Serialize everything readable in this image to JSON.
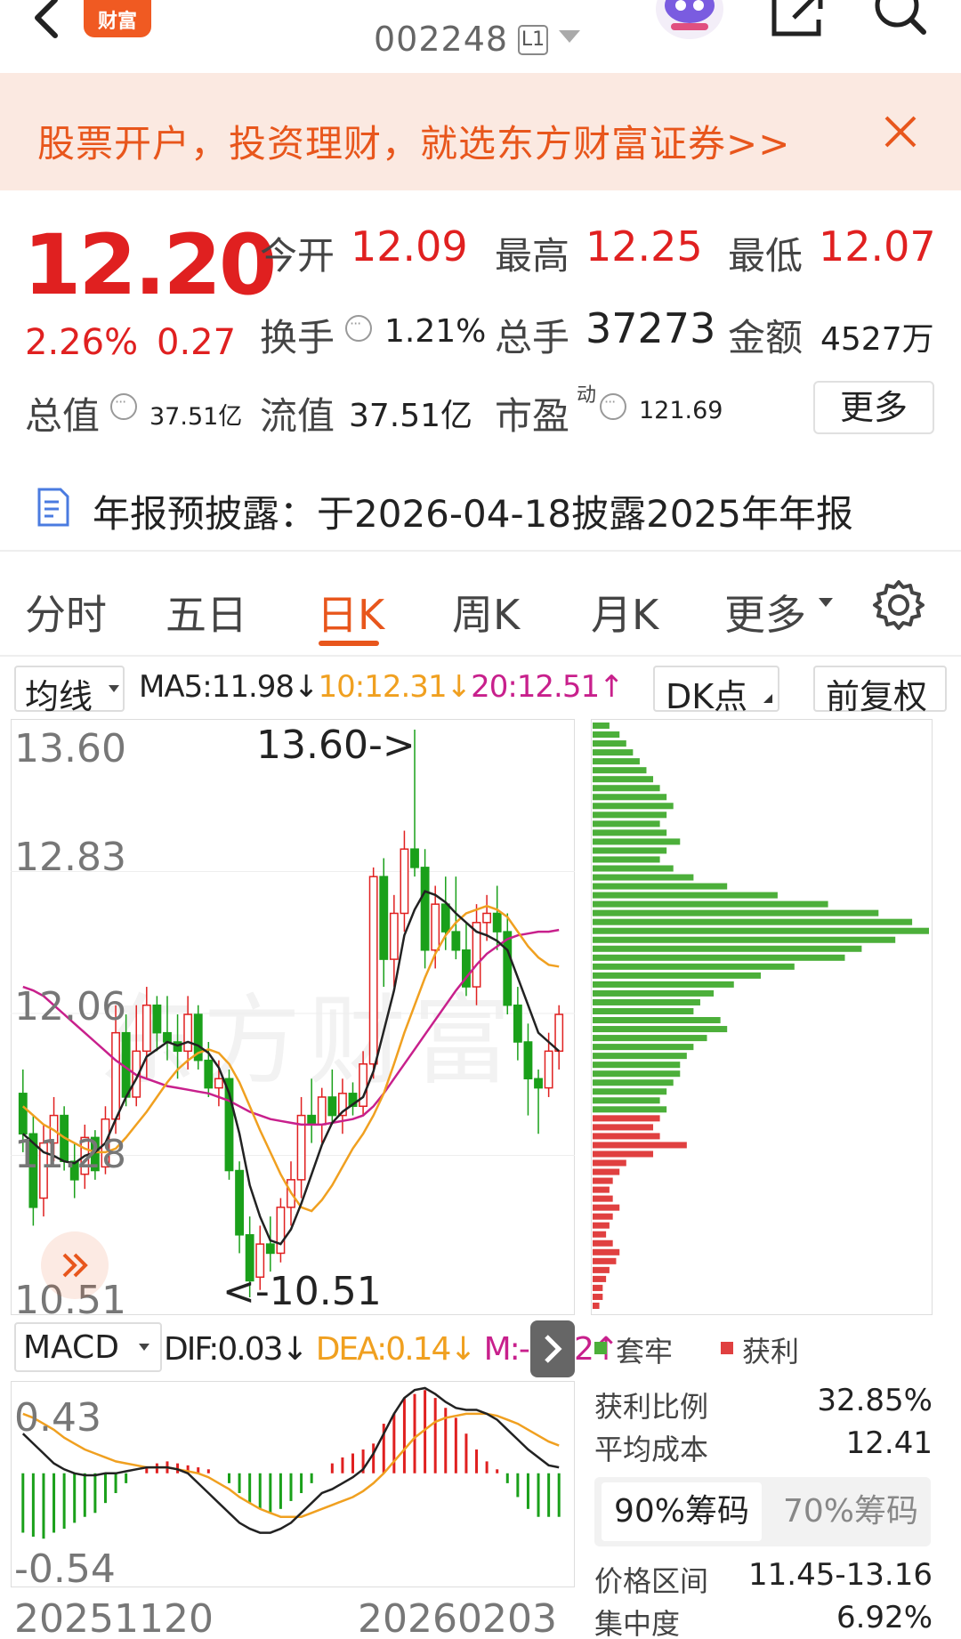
{
  "header": {
    "stock_code": "002248",
    "level_badge": "L1",
    "logo_text": "财富"
  },
  "banner": {
    "text": "股票开户，投资理财，就选东方财富证券>>"
  },
  "quote": {
    "price": "12.20",
    "change_pct": "2.26%",
    "change_amt": "0.27",
    "open_label": "今开",
    "open": "12.09",
    "high_label": "最高",
    "high": "12.25",
    "low_label": "最低",
    "low": "12.07",
    "turnover_label": "换手",
    "turnover": "1.21%",
    "volume_label": "总手",
    "volume": "37273",
    "amount_label": "金额",
    "amount": "4527万",
    "mktcap_label": "总值",
    "mktcap": "37.51亿",
    "float_label": "流值",
    "float": "37.51亿",
    "pe_label": "市盈",
    "pe_sup": "动",
    "pe": "121.69",
    "more_label": "更多"
  },
  "notice": {
    "text": "年报预披露：于2026-04-18披露2025年年报"
  },
  "tabs": [
    "分时",
    "五日",
    "日K",
    "周K",
    "月K",
    "更多"
  ],
  "active_tab": "日K",
  "chart_toolbar": {
    "indicator": "均线",
    "ma5": "MA5:11.98↓",
    "ma10": "10:12.31↓",
    "ma20": "20:12.51↑",
    "dk_label": "DK点",
    "adjust_label": "前复权"
  },
  "colors": {
    "up": "#e02020",
    "down": "#1aa01a",
    "ma5": "#222222",
    "ma10": "#f0a020",
    "ma20": "#c8208c",
    "accent": "#e8561c"
  },
  "kline": {
    "y_labels": [
      "13.60",
      "12.83",
      "12.06",
      "11.28",
      "10.51"
    ],
    "high_marker": "13.60->",
    "low_marker": "<-10.51",
    "watermark": "东方财富"
  },
  "macd": {
    "indicator": "MACD",
    "dif": "DIF:0.03↓",
    "dea": "DEA:0.14↓",
    "m": "M:-0.22↑",
    "y_top": "0.43",
    "y_bottom": "-0.54",
    "date_start": "20251120",
    "date_end": "20260203"
  },
  "chips": {
    "legend_loss": "套牢",
    "legend_profit": "获利",
    "profit_ratio_label": "获利比例",
    "profit_ratio": "32.85%",
    "avg_cost_label": "平均成本",
    "avg_cost": "12.41",
    "tab_90": "90%筹码",
    "tab_70": "70%筹码",
    "range_label": "价格区间",
    "range": "11.45-13.16",
    "concentration_label": "集中度",
    "concentration": "6.92%"
  },
  "chart_data": {
    "type": "candlestick",
    "price_range": [
      10.51,
      13.6
    ],
    "candles": [
      {
        "o": 11.62,
        "h": 11.75,
        "l": 11.3,
        "c": 11.4
      },
      {
        "o": 11.4,
        "h": 11.5,
        "l": 10.9,
        "c": 11.0
      },
      {
        "o": 11.05,
        "h": 11.45,
        "l": 10.95,
        "c": 11.35
      },
      {
        "o": 11.35,
        "h": 11.6,
        "l": 11.25,
        "c": 11.5
      },
      {
        "o": 11.5,
        "h": 11.55,
        "l": 11.2,
        "c": 11.25
      },
      {
        "o": 11.25,
        "h": 11.35,
        "l": 11.05,
        "c": 11.15
      },
      {
        "o": 11.18,
        "h": 11.45,
        "l": 11.1,
        "c": 11.38
      },
      {
        "o": 11.38,
        "h": 11.42,
        "l": 11.15,
        "c": 11.2
      },
      {
        "o": 11.22,
        "h": 11.55,
        "l": 11.18,
        "c": 11.48
      },
      {
        "o": 11.48,
        "h": 12.1,
        "l": 11.4,
        "c": 11.95
      },
      {
        "o": 11.95,
        "h": 12.05,
        "l": 11.55,
        "c": 11.6
      },
      {
        "o": 11.6,
        "h": 12.1,
        "l": 11.55,
        "c": 11.85
      },
      {
        "o": 11.85,
        "h": 12.2,
        "l": 11.7,
        "c": 12.1
      },
      {
        "o": 12.1,
        "h": 12.15,
        "l": 11.85,
        "c": 11.95
      },
      {
        "o": 11.95,
        "h": 12.15,
        "l": 11.8,
        "c": 11.9
      },
      {
        "o": 11.9,
        "h": 12.05,
        "l": 11.7,
        "c": 11.85
      },
      {
        "o": 11.85,
        "h": 12.15,
        "l": 11.75,
        "c": 12.05
      },
      {
        "o": 12.05,
        "h": 12.1,
        "l": 11.75,
        "c": 11.8
      },
      {
        "o": 11.8,
        "h": 11.9,
        "l": 11.6,
        "c": 11.65
      },
      {
        "o": 11.65,
        "h": 11.8,
        "l": 11.55,
        "c": 11.7
      },
      {
        "o": 11.7,
        "h": 11.75,
        "l": 11.15,
        "c": 11.2
      },
      {
        "o": 11.2,
        "h": 11.25,
        "l": 10.75,
        "c": 10.85
      },
      {
        "o": 10.85,
        "h": 10.95,
        "l": 10.51,
        "c": 10.6
      },
      {
        "o": 10.62,
        "h": 10.9,
        "l": 10.55,
        "c": 10.8
      },
      {
        "o": 10.8,
        "h": 10.95,
        "l": 10.65,
        "c": 10.75
      },
      {
        "o": 10.75,
        "h": 11.05,
        "l": 10.7,
        "c": 11.0
      },
      {
        "o": 11.0,
        "h": 11.25,
        "l": 10.9,
        "c": 11.15
      },
      {
        "o": 11.15,
        "h": 11.6,
        "l": 11.05,
        "c": 11.5
      },
      {
        "o": 11.5,
        "h": 11.7,
        "l": 11.35,
        "c": 11.45
      },
      {
        "o": 11.45,
        "h": 11.65,
        "l": 11.35,
        "c": 11.6
      },
      {
        "o": 11.6,
        "h": 11.75,
        "l": 11.45,
        "c": 11.5
      },
      {
        "o": 11.5,
        "h": 11.7,
        "l": 11.4,
        "c": 11.62
      },
      {
        "o": 11.62,
        "h": 11.68,
        "l": 11.5,
        "c": 11.55
      },
      {
        "o": 11.55,
        "h": 11.85,
        "l": 11.5,
        "c": 11.78
      },
      {
        "o": 11.78,
        "h": 12.85,
        "l": 11.7,
        "c": 12.8
      },
      {
        "o": 12.8,
        "h": 12.9,
        "l": 12.2,
        "c": 12.35
      },
      {
        "o": 12.35,
        "h": 12.7,
        "l": 12.2,
        "c": 12.6
      },
      {
        "o": 12.6,
        "h": 13.05,
        "l": 12.5,
        "c": 12.95
      },
      {
        "o": 12.95,
        "h": 13.6,
        "l": 12.8,
        "c": 12.85
      },
      {
        "o": 12.85,
        "h": 12.95,
        "l": 12.3,
        "c": 12.4
      },
      {
        "o": 12.4,
        "h": 12.75,
        "l": 12.3,
        "c": 12.65
      },
      {
        "o": 12.65,
        "h": 12.8,
        "l": 12.4,
        "c": 12.5
      },
      {
        "o": 12.5,
        "h": 12.8,
        "l": 12.35,
        "c": 12.4
      },
      {
        "o": 12.4,
        "h": 12.55,
        "l": 12.15,
        "c": 12.2
      },
      {
        "o": 12.2,
        "h": 12.65,
        "l": 12.1,
        "c": 12.55
      },
      {
        "o": 12.55,
        "h": 12.7,
        "l": 12.45,
        "c": 12.6
      },
      {
        "o": 12.6,
        "h": 12.75,
        "l": 12.4,
        "c": 12.5
      },
      {
        "o": 12.5,
        "h": 12.6,
        "l": 12.05,
        "c": 12.1
      },
      {
        "o": 12.1,
        "h": 12.2,
        "l": 11.8,
        "c": 11.9
      },
      {
        "o": 11.9,
        "h": 12.0,
        "l": 11.5,
        "c": 11.7
      },
      {
        "o": 11.7,
        "h": 11.75,
        "l": 11.4,
        "c": 11.65
      },
      {
        "o": 11.65,
        "h": 11.95,
        "l": 11.6,
        "c": 11.85
      },
      {
        "o": 11.85,
        "h": 12.1,
        "l": 11.75,
        "c": 12.05
      }
    ],
    "ma5": [
      11.4,
      11.35,
      11.3,
      11.28,
      11.25,
      11.24,
      11.28,
      11.3,
      11.35,
      11.48,
      11.6,
      11.7,
      11.82,
      11.86,
      11.9,
      11.88,
      11.9,
      11.88,
      11.84,
      11.76,
      11.62,
      11.4,
      11.12,
      10.95,
      10.82,
      10.8,
      10.88,
      11.02,
      11.18,
      11.34,
      11.46,
      11.52,
      11.56,
      11.6,
      11.74,
      11.96,
      12.18,
      12.48,
      12.62,
      12.72,
      12.7,
      12.66,
      12.6,
      12.55,
      12.5,
      12.48,
      12.45,
      12.4,
      12.25,
      12.1,
      11.95,
      11.9,
      11.85
    ],
    "ma10": [
      11.55,
      11.5,
      11.45,
      11.42,
      11.38,
      11.35,
      11.32,
      11.3,
      11.3,
      11.32,
      11.38,
      11.45,
      11.52,
      11.6,
      11.68,
      11.75,
      11.8,
      11.84,
      11.86,
      11.84,
      11.78,
      11.68,
      11.55,
      11.42,
      11.3,
      11.18,
      11.08,
      11.0,
      10.98,
      11.04,
      11.12,
      11.22,
      11.32,
      11.4,
      11.5,
      11.62,
      11.78,
      11.95,
      12.1,
      12.25,
      12.38,
      12.48,
      12.55,
      12.6,
      12.62,
      12.64,
      12.62,
      12.58,
      12.5,
      12.42,
      12.36,
      12.32,
      12.31
    ],
    "ma20": [
      12.2,
      12.18,
      12.15,
      12.1,
      12.05,
      12.0,
      11.95,
      11.9,
      11.85,
      11.8,
      11.76,
      11.72,
      11.7,
      11.68,
      11.66,
      11.65,
      11.64,
      11.63,
      11.62,
      11.6,
      11.58,
      11.55,
      11.52,
      11.5,
      11.48,
      11.47,
      11.46,
      11.45,
      11.45,
      11.45,
      11.46,
      11.47,
      11.48,
      11.5,
      11.55,
      11.62,
      11.7,
      11.78,
      11.86,
      11.94,
      12.02,
      12.1,
      12.18,
      12.25,
      12.32,
      12.38,
      12.42,
      12.46,
      12.48,
      12.49,
      12.5,
      12.5,
      12.51
    ],
    "macd_hist": [
      -0.3,
      -0.32,
      -0.33,
      -0.3,
      -0.28,
      -0.25,
      -0.22,
      -0.2,
      -0.15,
      -0.1,
      -0.05,
      0.0,
      0.03,
      0.05,
      0.06,
      0.05,
      0.04,
      0.03,
      0.02,
      0.0,
      -0.05,
      -0.1,
      -0.15,
      -0.18,
      -0.2,
      -0.18,
      -0.14,
      -0.1,
      -0.05,
      0.0,
      0.05,
      0.08,
      0.1,
      0.12,
      0.15,
      0.25,
      0.3,
      0.38,
      0.4,
      0.42,
      0.38,
      0.33,
      0.28,
      0.2,
      0.12,
      0.06,
      0.02,
      -0.05,
      -0.12,
      -0.18,
      -0.22,
      -0.22,
      -0.22
    ],
    "dif": [
      0.2,
      0.15,
      0.1,
      0.05,
      0.02,
      0.0,
      -0.01,
      -0.01,
      0.0,
      0.0,
      0.01,
      0.02,
      0.03,
      0.03,
      0.03,
      0.02,
      0.0,
      -0.05,
      -0.1,
      -0.15,
      -0.2,
      -0.25,
      -0.28,
      -0.3,
      -0.3,
      -0.28,
      -0.25,
      -0.2,
      -0.15,
      -0.1,
      -0.08,
      -0.05,
      -0.02,
      0.02,
      0.1,
      0.2,
      0.3,
      0.38,
      0.42,
      0.43,
      0.4,
      0.36,
      0.33,
      0.32,
      0.32,
      0.3,
      0.27,
      0.22,
      0.17,
      0.12,
      0.08,
      0.04,
      0.03
    ],
    "dea": [
      0.3,
      0.28,
      0.25,
      0.22,
      0.18,
      0.15,
      0.12,
      0.1,
      0.08,
      0.06,
      0.05,
      0.04,
      0.03,
      0.03,
      0.03,
      0.02,
      0.01,
      0.0,
      -0.02,
      -0.05,
      -0.08,
      -0.12,
      -0.15,
      -0.18,
      -0.2,
      -0.22,
      -0.22,
      -0.22,
      -0.2,
      -0.18,
      -0.16,
      -0.14,
      -0.12,
      -0.09,
      -0.05,
      0.0,
      0.06,
      0.12,
      0.18,
      0.22,
      0.26,
      0.28,
      0.29,
      0.3,
      0.3,
      0.3,
      0.29,
      0.27,
      0.25,
      0.22,
      0.19,
      0.16,
      0.14
    ],
    "macd_range": [
      -0.54,
      0.43
    ],
    "chip_profit_split": 0.33,
    "chip_distribution": [
      0.05,
      0.08,
      0.1,
      0.12,
      0.14,
      0.16,
      0.18,
      0.2,
      0.22,
      0.24,
      0.22,
      0.2,
      0.22,
      0.26,
      0.22,
      0.2,
      0.24,
      0.3,
      0.4,
      0.55,
      0.7,
      0.85,
      0.95,
      1.0,
      0.9,
      0.8,
      0.75,
      0.6,
      0.5,
      0.42,
      0.36,
      0.32,
      0.3,
      0.38,
      0.4,
      0.34,
      0.3,
      0.28,
      0.26,
      0.26,
      0.24,
      0.22,
      0.2,
      0.22,
      0.2,
      0.18,
      0.2,
      0.28,
      0.18,
      0.1,
      0.08,
      0.06,
      0.05,
      0.06,
      0.08,
      0.06,
      0.05,
      0.04,
      0.06,
      0.08,
      0.07,
      0.05,
      0.04,
      0.03,
      0.03,
      0.02
    ]
  }
}
